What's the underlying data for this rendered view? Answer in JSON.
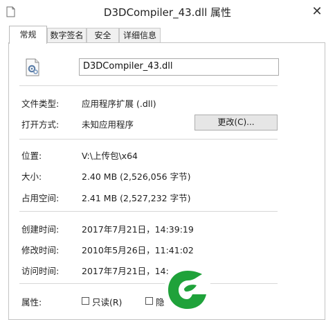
{
  "window": {
    "title": "D3DCompiler_43.dll 属性",
    "close_glyph": "✕"
  },
  "tabs": [
    {
      "label": "常规",
      "active": true
    },
    {
      "label": "数字签名",
      "active": false
    },
    {
      "label": "安全",
      "active": false
    },
    {
      "label": "详细信息",
      "active": false
    }
  ],
  "general": {
    "file_name": "D3DCompiler_43.dll",
    "file_type_label": "文件类型:",
    "file_type_value": "应用程序扩展 (.dll)",
    "open_with_label": "打开方式:",
    "open_with_value": "未知应用程序",
    "change_button": "更改(C)...",
    "location_label": "位置:",
    "location_value": "V:\\上传包\\x64",
    "size_label": "大小:",
    "size_value": "2.40 MB (2,526,056 字节)",
    "size_on_disk_label": "占用空间:",
    "size_on_disk_value": "2.41 MB (2,527,232 字节)",
    "created_label": "创建时间:",
    "created_value": "2017年7月21日，14:39:19",
    "modified_label": "修改时间:",
    "modified_value": "2010年5月26日，11:41:02",
    "accessed_label": "访问时间:",
    "accessed_value": "2017年7月21日，14:",
    "attributes_label": "属性:",
    "readonly_label": "只读(R)",
    "hidden_label": "隐"
  },
  "colors": {
    "logo_green": "#1fa23a",
    "window_bg": "#ffffff",
    "tab_bg": "#f0f0f0"
  },
  "icons": {
    "title_icon": "document-icon",
    "file_icon": "dll-gear-file-icon",
    "logo": "green-leaf-logo-icon"
  }
}
